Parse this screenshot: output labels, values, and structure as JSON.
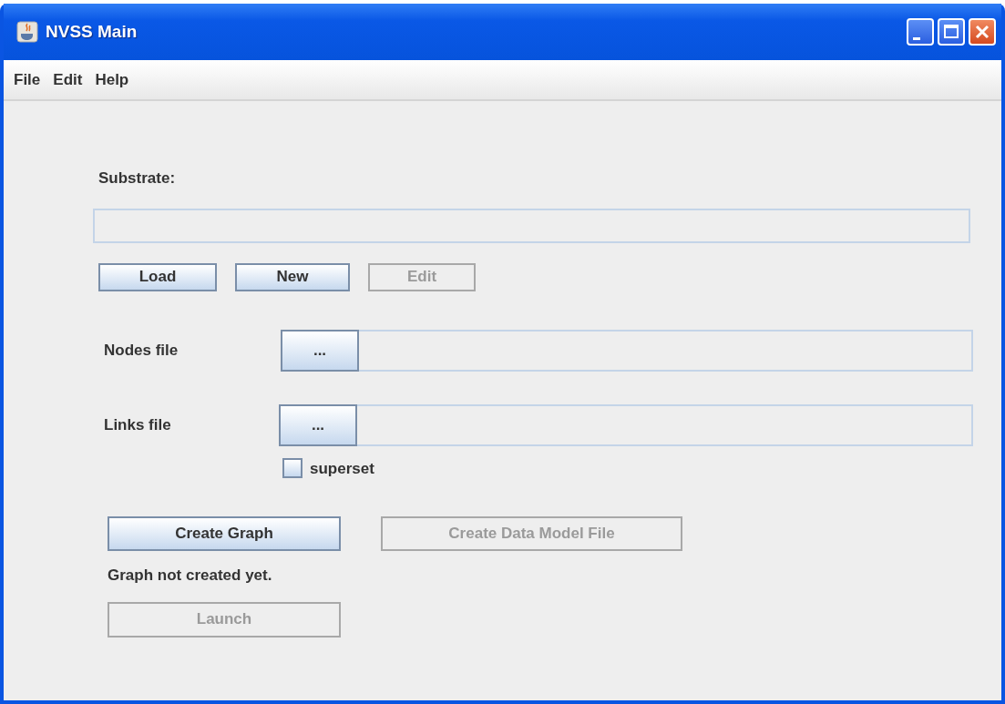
{
  "window": {
    "title": "NVSS Main"
  },
  "menu": [
    "File",
    "Edit",
    "Help"
  ],
  "substrate": {
    "label": "Substrate:",
    "buttons": [
      {
        "label": "Load",
        "disabled": false
      },
      {
        "label": "New",
        "disabled": false
      },
      {
        "label": "Edit",
        "disabled": true
      }
    ]
  },
  "file_rows": [
    {
      "label": "Nodes file",
      "button": "..."
    },
    {
      "label": "Links file",
      "button": "..."
    }
  ],
  "superset": {
    "label": "superset",
    "checked": false
  },
  "actions": [
    {
      "label": "Create Graph",
      "disabled": false
    },
    {
      "label": "Create Data Model File",
      "disabled": true
    }
  ],
  "status": "Graph not created yet.",
  "launch": {
    "label": "Launch",
    "disabled": true
  }
}
